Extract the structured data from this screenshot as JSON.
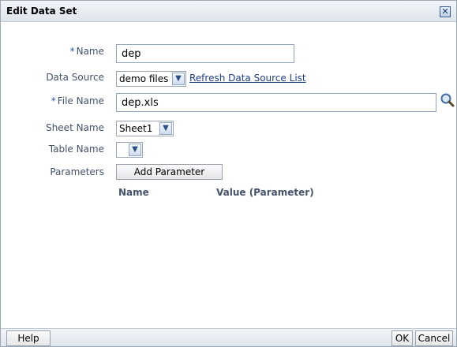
{
  "dialog": {
    "title": "Edit Data Set",
    "close_icon": "close-icon"
  },
  "form": {
    "name": {
      "label": "Name",
      "value": "dep"
    },
    "data_source": {
      "label": "Data Source",
      "selected": "demo files",
      "refresh_link": "Refresh Data Source List"
    },
    "file_name": {
      "label": "File Name",
      "value": "dep.xls",
      "browse_icon": "search-icon"
    },
    "sheet_name": {
      "label": "Sheet Name",
      "selected": "Sheet1"
    },
    "table_name": {
      "label": "Table Name",
      "selected": ""
    },
    "parameters": {
      "label": "Parameters",
      "add_button": "Add Parameter",
      "columns": [
        "Name",
        "Value (Parameter)"
      ]
    },
    "required_marker": "*"
  },
  "footer": {
    "help_button": "Help",
    "ok_button": "OK",
    "cancel_button": "Cancel"
  },
  "colors": {
    "label": "#43536b",
    "required": "#2a54a6",
    "link": "#1d3e8a",
    "titlebar": "#dfe5ec"
  }
}
